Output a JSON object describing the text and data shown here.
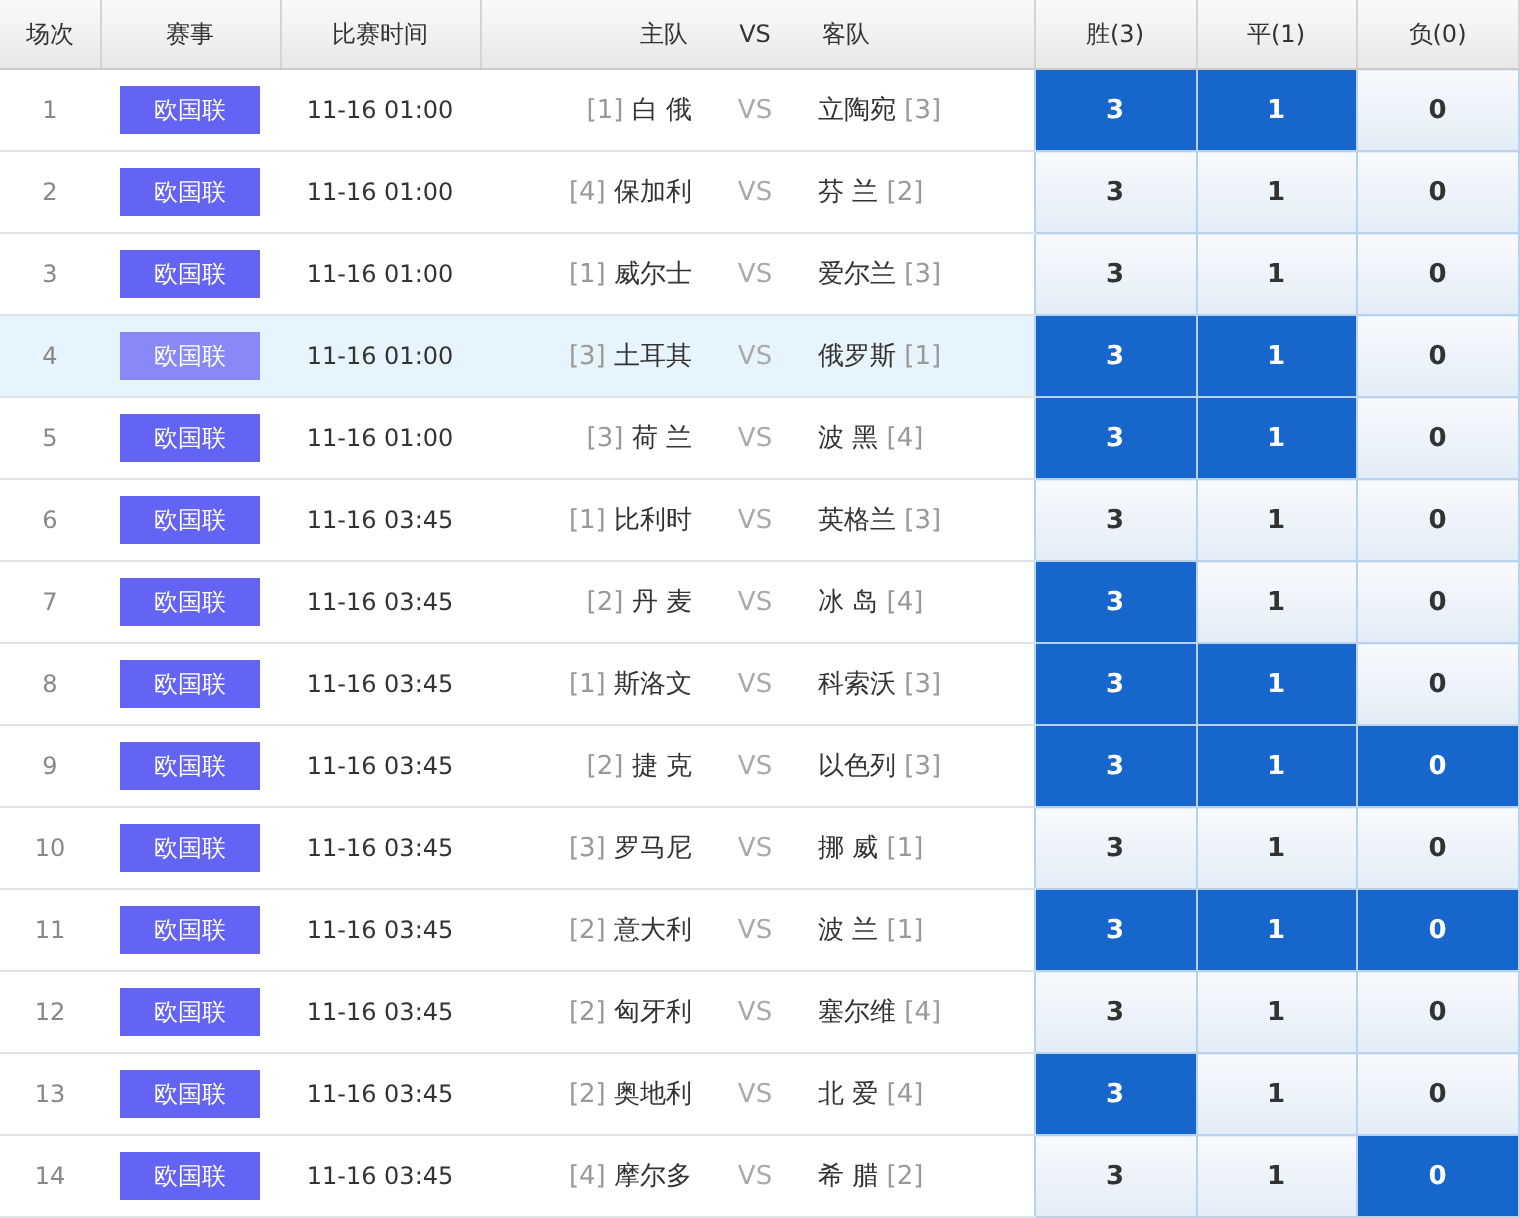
{
  "columns": [
    "场次",
    "赛事",
    "比赛时间",
    "主队",
    "VS",
    "客队",
    "胜(3)",
    "平(1)",
    "负(0)"
  ],
  "rows": [
    {
      "no": "1",
      "league": "欧国联",
      "time": "11-16 01:00",
      "home_seed": "[1]",
      "home": "白 俄",
      "vs": "VS",
      "away": "立陶宛",
      "away_seed": "[3]",
      "hovered": false,
      "picks": [
        {
          "label": "3",
          "selected": true
        },
        {
          "label": "1",
          "selected": true
        },
        {
          "label": "0",
          "selected": false
        }
      ]
    },
    {
      "no": "2",
      "league": "欧国联",
      "time": "11-16 01:00",
      "home_seed": "[4]",
      "home": "保加利",
      "vs": "VS",
      "away": "芬 兰",
      "away_seed": "[2]",
      "hovered": false,
      "picks": [
        {
          "label": "3",
          "selected": false
        },
        {
          "label": "1",
          "selected": false
        },
        {
          "label": "0",
          "selected": false
        }
      ]
    },
    {
      "no": "3",
      "league": "欧国联",
      "time": "11-16 01:00",
      "home_seed": "[1]",
      "home": "威尔士",
      "vs": "VS",
      "away": "爱尔兰",
      "away_seed": "[3]",
      "hovered": false,
      "picks": [
        {
          "label": "3",
          "selected": false
        },
        {
          "label": "1",
          "selected": false
        },
        {
          "label": "0",
          "selected": false
        }
      ]
    },
    {
      "no": "4",
      "league": "欧国联",
      "time": "11-16 01:00",
      "home_seed": "[3]",
      "home": "土耳其",
      "vs": "VS",
      "away": "俄罗斯",
      "away_seed": "[1]",
      "hovered": true,
      "picks": [
        {
          "label": "3",
          "selected": true
        },
        {
          "label": "1",
          "selected": true
        },
        {
          "label": "0",
          "selected": false
        }
      ]
    },
    {
      "no": "5",
      "league": "欧国联",
      "time": "11-16 01:00",
      "home_seed": "[3]",
      "home": "荷 兰",
      "vs": "VS",
      "away": "波 黑",
      "away_seed": "[4]",
      "hovered": false,
      "picks": [
        {
          "label": "3",
          "selected": true
        },
        {
          "label": "1",
          "selected": true
        },
        {
          "label": "0",
          "selected": false
        }
      ]
    },
    {
      "no": "6",
      "league": "欧国联",
      "time": "11-16 03:45",
      "home_seed": "[1]",
      "home": "比利时",
      "vs": "VS",
      "away": "英格兰",
      "away_seed": "[3]",
      "hovered": false,
      "picks": [
        {
          "label": "3",
          "selected": false
        },
        {
          "label": "1",
          "selected": false
        },
        {
          "label": "0",
          "selected": false
        }
      ]
    },
    {
      "no": "7",
      "league": "欧国联",
      "time": "11-16 03:45",
      "home_seed": "[2]",
      "home": "丹 麦",
      "vs": "VS",
      "away": "冰 岛",
      "away_seed": "[4]",
      "hovered": false,
      "picks": [
        {
          "label": "3",
          "selected": true
        },
        {
          "label": "1",
          "selected": false
        },
        {
          "label": "0",
          "selected": false
        }
      ]
    },
    {
      "no": "8",
      "league": "欧国联",
      "time": "11-16 03:45",
      "home_seed": "[1]",
      "home": "斯洛文",
      "vs": "VS",
      "away": "科索沃",
      "away_seed": "[3]",
      "hovered": false,
      "picks": [
        {
          "label": "3",
          "selected": true
        },
        {
          "label": "1",
          "selected": true
        },
        {
          "label": "0",
          "selected": false
        }
      ]
    },
    {
      "no": "9",
      "league": "欧国联",
      "time": "11-16 03:45",
      "home_seed": "[2]",
      "home": "捷 克",
      "vs": "VS",
      "away": "以色列",
      "away_seed": "[3]",
      "hovered": false,
      "picks": [
        {
          "label": "3",
          "selected": true
        },
        {
          "label": "1",
          "selected": true
        },
        {
          "label": "0",
          "selected": true
        }
      ]
    },
    {
      "no": "10",
      "league": "欧国联",
      "time": "11-16 03:45",
      "home_seed": "[3]",
      "home": "罗马尼",
      "vs": "VS",
      "away": "挪 威",
      "away_seed": "[1]",
      "hovered": false,
      "picks": [
        {
          "label": "3",
          "selected": false
        },
        {
          "label": "1",
          "selected": false
        },
        {
          "label": "0",
          "selected": false
        }
      ]
    },
    {
      "no": "11",
      "league": "欧国联",
      "time": "11-16 03:45",
      "home_seed": "[2]",
      "home": "意大利",
      "vs": "VS",
      "away": "波 兰",
      "away_seed": "[1]",
      "hovered": false,
      "picks": [
        {
          "label": "3",
          "selected": true
        },
        {
          "label": "1",
          "selected": true
        },
        {
          "label": "0",
          "selected": true
        }
      ]
    },
    {
      "no": "12",
      "league": "欧国联",
      "time": "11-16 03:45",
      "home_seed": "[2]",
      "home": "匈牙利",
      "vs": "VS",
      "away": "塞尔维",
      "away_seed": "[4]",
      "hovered": false,
      "picks": [
        {
          "label": "3",
          "selected": false
        },
        {
          "label": "1",
          "selected": false
        },
        {
          "label": "0",
          "selected": false
        }
      ]
    },
    {
      "no": "13",
      "league": "欧国联",
      "time": "11-16 03:45",
      "home_seed": "[2]",
      "home": "奥地利",
      "vs": "VS",
      "away": "北 爱",
      "away_seed": "[4]",
      "hovered": false,
      "picks": [
        {
          "label": "3",
          "selected": true
        },
        {
          "label": "1",
          "selected": false
        },
        {
          "label": "0",
          "selected": false
        }
      ]
    },
    {
      "no": "14",
      "league": "欧国联",
      "time": "11-16 03:45",
      "home_seed": "[4]",
      "home": "摩尔多",
      "vs": "VS",
      "away": "希 腊",
      "away_seed": "[2]",
      "hovered": false,
      "picks": [
        {
          "label": "3",
          "selected": false
        },
        {
          "label": "1",
          "selected": false
        },
        {
          "label": "0",
          "selected": true
        }
      ]
    }
  ]
}
